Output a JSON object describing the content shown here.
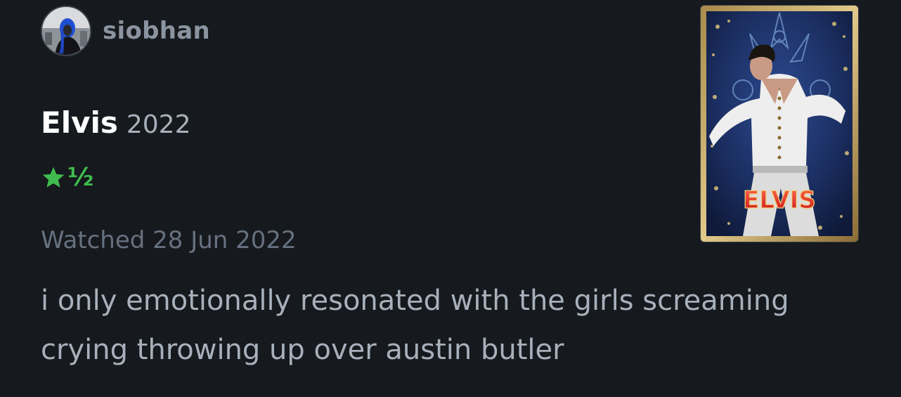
{
  "author": {
    "name": "siobhan",
    "avatar_icon": "profile-photo"
  },
  "film": {
    "title": "Elvis",
    "year": "2022",
    "poster_title": "ELVIS"
  },
  "rating": {
    "stars": 1.5,
    "full_stars": "★",
    "half_star": "½",
    "color": "#40bc4f"
  },
  "watched": "Watched 28 Jun 2022",
  "review": "i only emotionally resonated with the girls screaming crying throwing up over austin butler"
}
